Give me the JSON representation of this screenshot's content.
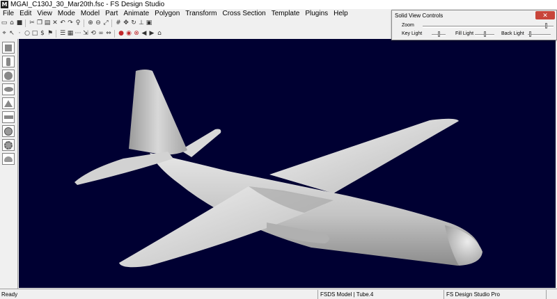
{
  "window": {
    "app_icon": "fsds-app-icon",
    "title": "MGAI_C130J_30_Mar20th.fsc - FS Design Studio"
  },
  "menu": {
    "items": [
      "File",
      "Edit",
      "View",
      "Mode",
      "Model",
      "Part",
      "Animate",
      "Polygon",
      "Transform",
      "Cross Section",
      "Template",
      "Plugins",
      "Help"
    ]
  },
  "toolbar_row1": {
    "icons": [
      "new-file-icon",
      "open-folder-icon",
      "save-icon",
      "cut-icon",
      "copy-icon",
      "paste-icon",
      "delete-icon",
      "undo-icon",
      "redo-icon",
      "light-bulb-icon",
      "zoom-in-icon",
      "zoom-out-icon",
      "fit-view-icon",
      "grid-icon",
      "pan-icon",
      "rotate-icon",
      "axes-icon",
      "display-icon"
    ]
  },
  "toolbar_row2": {
    "icons": [
      "select-icon",
      "cursor-icon",
      "point-icon",
      "circle-icon",
      "rectangle-icon",
      "dollar-icon",
      "flag-icon",
      "list-icon",
      "grid-view-icon",
      "sequence-icon",
      "scale-icon",
      "rotate-3d-icon",
      "link-icon",
      "mirror-icon",
      "red-stop-icon",
      "red-circle-icon",
      "red-record-icon",
      "arrow-left-icon",
      "arrow-right-icon",
      "warehouse-icon"
    ]
  },
  "shape_tools": {
    "icons": [
      "cube-shape-icon",
      "cylinder-shape-icon",
      "sphere-shape-icon",
      "ellipse-shape-icon",
      "cone-shape-icon",
      "wedge-shape-icon",
      "geosphere-shape-icon",
      "torus-shape-icon",
      "hemisphere-shape-icon"
    ]
  },
  "viewport": {
    "background_color": "#000032",
    "model_description_color": "#bfbfbf"
  },
  "solid_view_controls": {
    "title": "Solid View Controls",
    "close_glyph": "✕",
    "zoom_label": "Zoom",
    "zoom_value": 0.95,
    "key_light_label": "Key Light",
    "key_light_value": 0.5,
    "fill_light_label": "Fill Light",
    "fill_light_value": 0.5,
    "back_light_label": "Back Light",
    "back_light_value": 0.05
  },
  "statusbar": {
    "ready": "Ready",
    "model_info": "FSDS Model | Tube.4",
    "product": "FS Design Studio Pro"
  }
}
